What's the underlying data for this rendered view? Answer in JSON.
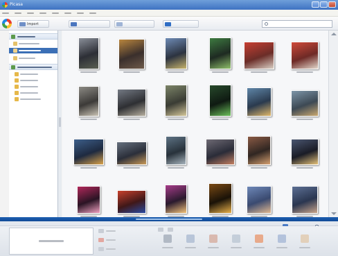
{
  "window": {
    "title": "Picasa"
  },
  "colors": {
    "accent": "#3b6fb6",
    "status_bar": "#1e5fb0"
  },
  "icons": [
    "picasa-logo-icon",
    "search-icon",
    "folder-icon",
    "album-icon",
    "import-icon",
    "slideshow-icon",
    "timeline-icon",
    "collage-icon",
    "zoom-icon",
    "chevron-up-icon",
    "chevron-down-icon"
  ],
  "toolbar": {
    "import_label": "Import",
    "slideshow_label": "",
    "timeline_label": "",
    "collage_label": "",
    "search_placeholder": ""
  },
  "photos": [
    {
      "name": "photo-1",
      "colors": [
        "#2d2f36",
        "#8a8f99",
        "#5a5f52"
      ]
    },
    {
      "name": "photo-2",
      "colors": [
        "#3a2f2c",
        "#b9863e",
        "#6e5a4a"
      ]
    },
    {
      "name": "photo-3",
      "colors": [
        "#2c3340",
        "#6e8bb5",
        "#c6b36b"
      ]
    },
    {
      "name": "photo-4",
      "colors": [
        "#1e2a22",
        "#3d7a40",
        "#8fbf6a"
      ]
    },
    {
      "name": "photo-5",
      "colors": [
        "#6b2d28",
        "#c73f32",
        "#d9cfc4"
      ]
    },
    {
      "name": "photo-6",
      "colors": [
        "#6e2a26",
        "#cf4a3a",
        "#e2d6ca"
      ]
    },
    {
      "name": "photo-7",
      "colors": [
        "#3c3a38",
        "#8c8a84",
        "#c9c3b5"
      ]
    },
    {
      "name": "photo-8",
      "colors": [
        "#2e2f33",
        "#747a84",
        "#b7b0a0"
      ]
    },
    {
      "name": "photo-9",
      "colors": [
        "#3a3c34",
        "#7c8468",
        "#d4c79a"
      ]
    },
    {
      "name": "photo-10",
      "colors": [
        "#0f1a12",
        "#27492b",
        "#6bbf5a"
      ]
    },
    {
      "name": "photo-11",
      "colors": [
        "#2a3a4e",
        "#5f86a8",
        "#e0b86a"
      ]
    },
    {
      "name": "photo-12",
      "colors": [
        "#3d4954",
        "#7d95a8",
        "#c9a870"
      ]
    },
    {
      "name": "photo-13",
      "colors": [
        "#1e2a40",
        "#3d5f8a",
        "#d9a24a"
      ]
    },
    {
      "name": "photo-14",
      "colors": [
        "#2b2f3a",
        "#66707e",
        "#c99a58"
      ]
    },
    {
      "name": "photo-15",
      "colors": [
        "#28323b",
        "#5d7284",
        "#a7b4bd"
      ]
    },
    {
      "name": "photo-16",
      "colors": [
        "#2a2c38",
        "#6e6a74",
        "#c48062"
      ]
    },
    {
      "name": "photo-17",
      "colors": [
        "#302622",
        "#8a5a44",
        "#d6a070"
      ]
    },
    {
      "name": "photo-18",
      "colors": [
        "#1a1c26",
        "#4a5670",
        "#e6c27a"
      ]
    },
    {
      "name": "photo-19",
      "colors": [
        "#2a1424",
        "#b0285a",
        "#f0a0c0"
      ]
    },
    {
      "name": "photo-20",
      "colors": [
        "#401818",
        "#c8402c",
        "#2a4aa0"
      ]
    },
    {
      "name": "photo-21",
      "colors": [
        "#2a1a2e",
        "#a63c8a",
        "#f2c27a"
      ]
    },
    {
      "name": "photo-22",
      "colors": [
        "#1a1208",
        "#7a4a14",
        "#e8b04a"
      ]
    },
    {
      "name": "photo-23",
      "colors": [
        "#3a4a70",
        "#6e88b8",
        "#e0b890"
      ]
    },
    {
      "name": "photo-24",
      "colors": [
        "#2a3650",
        "#5c6f94",
        "#c8a48a"
      ]
    }
  ]
}
